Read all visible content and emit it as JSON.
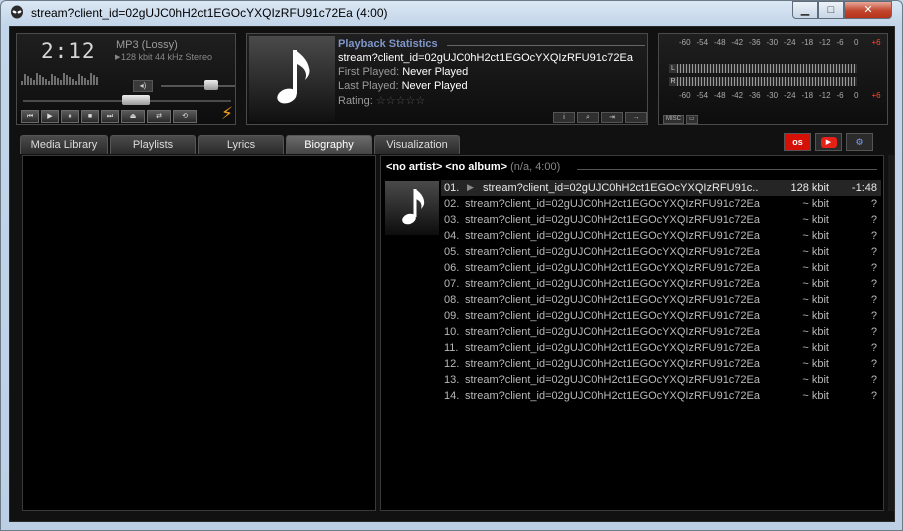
{
  "window": {
    "title": "stream?client_id=02gUJC0hH2ct1EGOcYXQIzRFU91c72Ea (4:00)",
    "buttons": {
      "minimize": "▁",
      "maximize": "□",
      "close": "✕"
    }
  },
  "player": {
    "time": "2:12",
    "codec": "MP3 (Lossy)",
    "bitrate": "128 kbit 44 kHz Stereo",
    "volume_icon": "speaker-icon",
    "volume_level": 0.72,
    "seek_position": 0.55,
    "transport": [
      "⏮",
      "▶",
      "⏸",
      "■",
      "⏭",
      "⏏",
      "⇄",
      "⟲"
    ]
  },
  "now_playing": {
    "heading": "Playback Statistics",
    "title": "stream?client_id=02gUJC0hH2ct1EGOcYXQIzRFU91c72Ea",
    "first_played_label": "First Played:",
    "first_played_value": "Never Played",
    "last_played_label": "Last Played:",
    "last_played_value": "Never Played",
    "rating_label": "Rating:",
    "rating_stars": "☆☆☆☆☆",
    "buttons": [
      "i",
      "⌕",
      "⇥",
      "→"
    ]
  },
  "meter": {
    "scale": [
      "-60",
      "-54",
      "-48",
      "-42",
      "-36",
      "-30",
      "-24",
      "-18",
      "-12",
      "-6",
      "0",
      "+6"
    ],
    "channels": [
      "L",
      "R"
    ],
    "foot": [
      "MISC",
      "▭"
    ]
  },
  "tabs": [
    {
      "label": "Media Library"
    },
    {
      "label": "Playlists"
    },
    {
      "label": "Lyrics"
    },
    {
      "label": "Biography",
      "active": true
    },
    {
      "label": "Visualization"
    }
  ],
  "tab_icons": {
    "lastfm": "os",
    "youtube": "▶",
    "config": "⚙"
  },
  "playlist": {
    "group_artist": "<no artist>",
    "group_album": "<no album>",
    "group_detail": "(n/a, 4:00)",
    "tracks": [
      {
        "num": "01.",
        "name": "stream?client_id=02gUJC0hH2ct1EGOcYXQIzRFU91c...",
        "bitrate": "128 kbit",
        "length": "-1:48",
        "current": true
      },
      {
        "num": "02.",
        "name": "stream?client_id=02gUJC0hH2ct1EGOcYXQIzRFU91c72Ea",
        "bitrate": "~ kbit",
        "length": "?"
      },
      {
        "num": "03.",
        "name": "stream?client_id=02gUJC0hH2ct1EGOcYXQIzRFU91c72Ea",
        "bitrate": "~ kbit",
        "length": "?"
      },
      {
        "num": "04.",
        "name": "stream?client_id=02gUJC0hH2ct1EGOcYXQIzRFU91c72Ea",
        "bitrate": "~ kbit",
        "length": "?"
      },
      {
        "num": "05.",
        "name": "stream?client_id=02gUJC0hH2ct1EGOcYXQIzRFU91c72Ea",
        "bitrate": "~ kbit",
        "length": "?"
      },
      {
        "num": "06.",
        "name": "stream?client_id=02gUJC0hH2ct1EGOcYXQIzRFU91c72Ea",
        "bitrate": "~ kbit",
        "length": "?"
      },
      {
        "num": "07.",
        "name": "stream?client_id=02gUJC0hH2ct1EGOcYXQIzRFU91c72Ea",
        "bitrate": "~ kbit",
        "length": "?"
      },
      {
        "num": "08.",
        "name": "stream?client_id=02gUJC0hH2ct1EGOcYXQIzRFU91c72Ea",
        "bitrate": "~ kbit",
        "length": "?"
      },
      {
        "num": "09.",
        "name": "stream?client_id=02gUJC0hH2ct1EGOcYXQIzRFU91c72Ea",
        "bitrate": "~ kbit",
        "length": "?"
      },
      {
        "num": "10.",
        "name": "stream?client_id=02gUJC0hH2ct1EGOcYXQIzRFU91c72Ea",
        "bitrate": "~ kbit",
        "length": "?"
      },
      {
        "num": "11.",
        "name": "stream?client_id=02gUJC0hH2ct1EGOcYXQIzRFU91c72Ea",
        "bitrate": "~ kbit",
        "length": "?"
      },
      {
        "num": "12.",
        "name": "stream?client_id=02gUJC0hH2ct1EGOcYXQIzRFU91c72Ea",
        "bitrate": "~ kbit",
        "length": "?"
      },
      {
        "num": "13.",
        "name": "stream?client_id=02gUJC0hH2ct1EGOcYXQIzRFU91c72Ea",
        "bitrate": "~ kbit",
        "length": "?"
      },
      {
        "num": "14.",
        "name": "stream?client_id=02gUJC0hH2ct1EGOcYXQIzRFU91c72Ea",
        "bitrate": "~ kbit",
        "length": "?"
      }
    ]
  }
}
